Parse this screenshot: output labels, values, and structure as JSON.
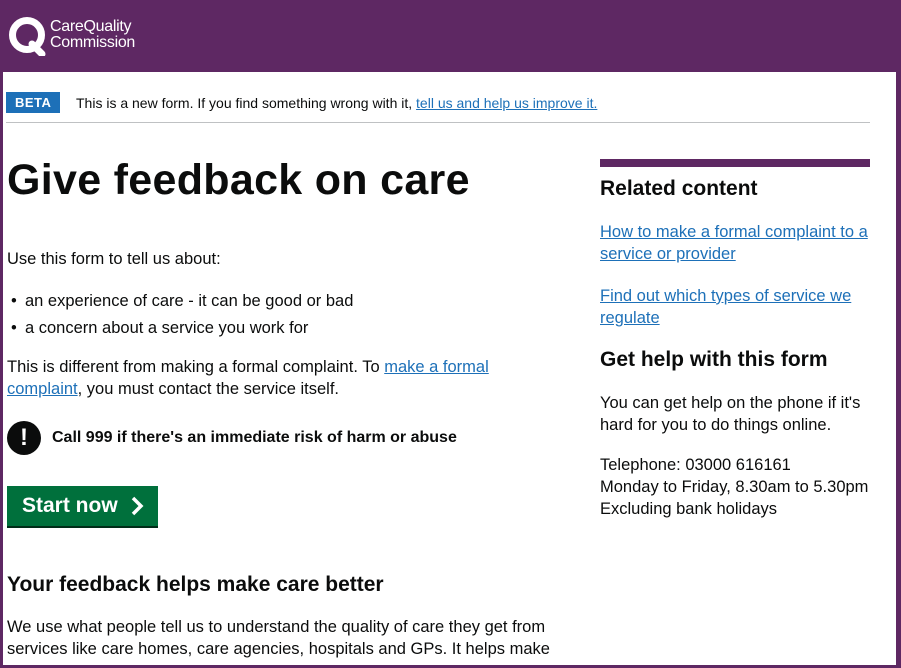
{
  "header": {
    "logo_line1": "CareQuality",
    "logo_line2": "Commission",
    "brand_color": "#5e2863"
  },
  "beta": {
    "tag": "BETA",
    "text": "This is a new form. If you find something wrong with it,",
    "link": "tell us and help us improve it."
  },
  "main": {
    "title": "Give feedback on care",
    "intro": "Use this form to tell us about:",
    "bullets": [
      "an experience of care - it can be good or bad",
      "a concern about a service you work for"
    ],
    "diff_prefix": "This is different from making a formal complaint. To ",
    "diff_link": "make a formal complaint",
    "diff_suffix": ", you must contact the service itself.",
    "warning": "Call 999 if there's an immediate risk of harm or abuse",
    "start_button": "Start now",
    "feedback_heading": "Your feedback helps make care better",
    "feedback_text": "We use what people tell us to understand the quality of care they get from services like care homes, care agencies, hospitals and GPs. It helps make"
  },
  "sidebar": {
    "related_title": "Related content",
    "related_links": [
      "How to make a formal complaint to a service or provider",
      "Find out which types of service we regulate"
    ],
    "help_title": "Get help with this form",
    "help_text": "You can get help on the phone if it's hard for you to do things online.",
    "telephone": "Telephone: 03000 616161",
    "hours": "Monday to Friday, 8.30am to 5.30pm",
    "exclusions": "Excluding bank holidays"
  }
}
